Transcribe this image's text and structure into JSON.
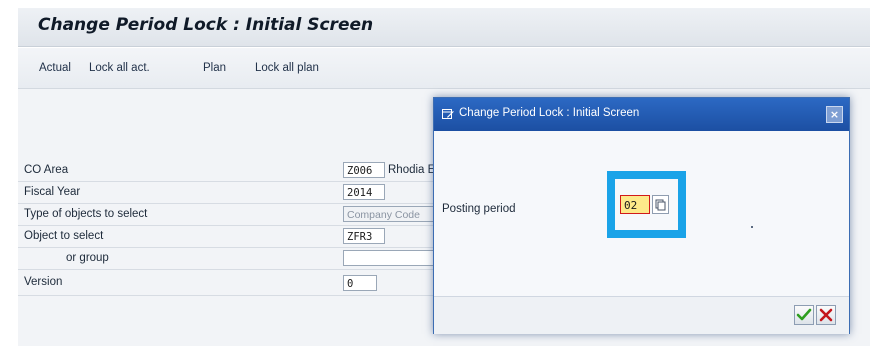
{
  "screen": {
    "title": "Change Period Lock : Initial Screen"
  },
  "toolbar": {
    "items": [
      {
        "label": "Actual"
      },
      {
        "label": "Lock all act."
      },
      {
        "label": "Plan"
      },
      {
        "label": "Lock all plan"
      }
    ]
  },
  "form": {
    "co_area": {
      "label": "CO Area",
      "value": "Z006",
      "description": "Rhodia E"
    },
    "fiscal_year": {
      "label": "Fiscal Year",
      "value": "2014"
    },
    "type_objects": {
      "label": "Type of objects to select",
      "value": "Company Code"
    },
    "object_select": {
      "label": "Object to select",
      "value": "ZFR3"
    },
    "or_group": {
      "label": "or group",
      "value": ""
    },
    "version": {
      "label": "Version",
      "value": "0"
    }
  },
  "dialog": {
    "title": "Change Period Lock : Initial Screen",
    "close_label": "×",
    "posting_period_label": "Posting period",
    "posting_period_value": "02"
  },
  "colors": {
    "dialog_title_bg": "#1c4fa3",
    "highlight": "#1aa3e8",
    "required_field_bg": "#fde98a",
    "ok_green": "#2e9e1f",
    "cancel_red": "#c4161c"
  },
  "icons": {
    "dialog_icon": "window-edit-icon",
    "f4_help": "value-help-icon",
    "ok": "checkmark-icon",
    "cancel": "cancel-x-icon"
  }
}
